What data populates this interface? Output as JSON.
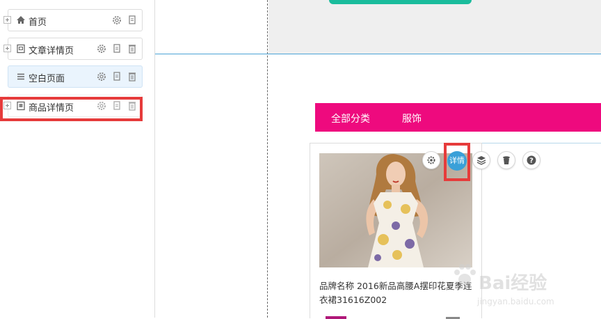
{
  "sidebar": {
    "items": [
      {
        "label": "首页",
        "icon": "home-icon"
      },
      {
        "label": "文章详情页",
        "icon": "article-icon"
      },
      {
        "label": "空白页面",
        "icon": "list-icon"
      },
      {
        "label": "商品详情页",
        "icon": "product-page-icon"
      }
    ],
    "selected_index": 2,
    "highlighted_index": 3
  },
  "canvas": {
    "categories": [
      "全部分类",
      "服饰"
    ],
    "category_bar_color": "#ee0a7e",
    "product": {
      "name": "品牌名称 2016新品高腰A摆印花夏季连衣裙31616Z002"
    },
    "toolbar": {
      "detail_label": "详情",
      "buttons": [
        "gear-icon",
        "layers-icon",
        "trash-icon",
        "help-icon"
      ]
    }
  },
  "watermark": {
    "text": "Bai经验",
    "sub": "jingyan.baidu.com"
  },
  "colors": {
    "accent_teal": "#1abc9c",
    "highlight_red": "#e63b3b",
    "detail_blue": "#3aa0d8"
  }
}
